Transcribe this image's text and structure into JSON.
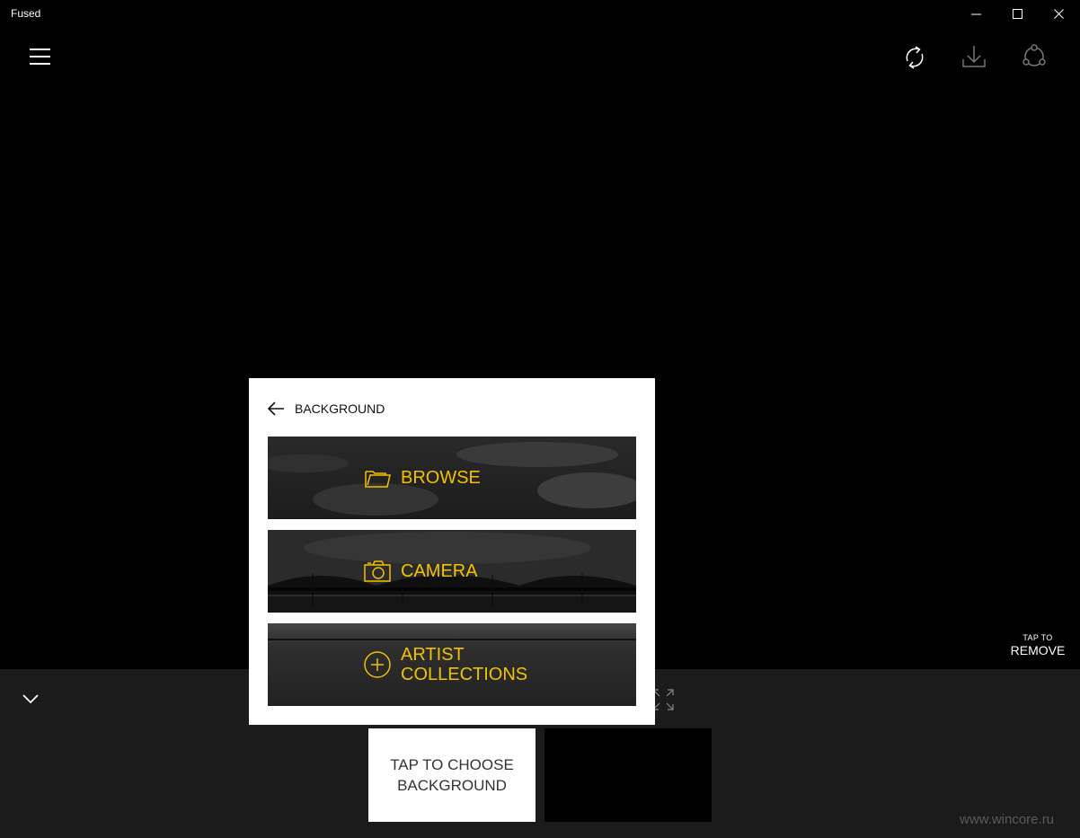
{
  "window": {
    "title": "Fused"
  },
  "toolbar": {
    "icons": [
      "hamburger-menu-icon",
      "refresh-icon",
      "download-icon",
      "share-icon"
    ]
  },
  "canvas": {
    "tap_to_small": "TAP TO",
    "tap_to_action": "REMOVE"
  },
  "dialog": {
    "title": "BACKGROUND",
    "options": [
      {
        "label": "BROWSE",
        "icon": "folder-icon"
      },
      {
        "label": "CAMERA",
        "icon": "camera-icon"
      },
      {
        "label_line1": "ARTIST",
        "label_line2": "COLLECTIONS",
        "icon": "plus-circle-icon"
      }
    ]
  },
  "bottom": {
    "choose_background": "TAP TO CHOOSE BACKGROUND"
  },
  "watermark": "www.wincore.ru",
  "colors": {
    "accent": "#f2c200",
    "background": "#000000",
    "panel": "#1b1b1b"
  }
}
